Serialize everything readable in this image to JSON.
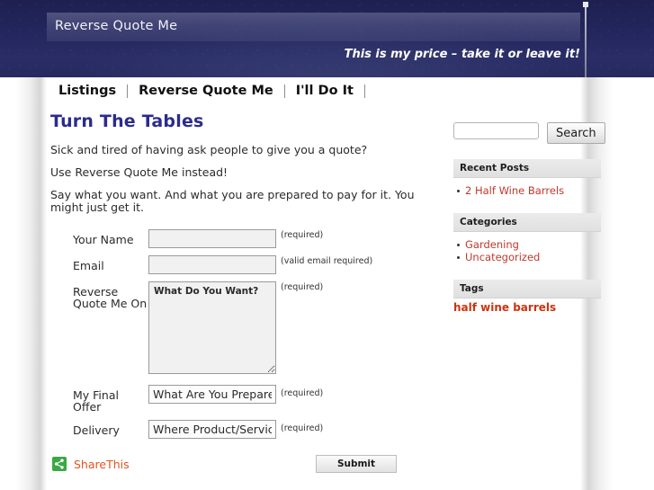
{
  "header": {
    "site_title": "Reverse Quote Me",
    "tagline": "This is my price – take it or leave it!",
    "bg_color": "#23265c",
    "title_text_color": "#f2f2f7"
  },
  "nav": {
    "items": [
      {
        "label": "Listings"
      },
      {
        "label": "Reverse Quote Me"
      },
      {
        "label": "I'll Do It"
      }
    ]
  },
  "main": {
    "page_title": "Turn The Tables",
    "page_title_color": "#2b2b8f",
    "paragraphs": [
      "Sick and tired of having ask people to give you a quote?",
      "Use Reverse Quote Me instead!",
      "Say what you want. And what you are prepared to pay for it. You might just get it."
    ],
    "form": {
      "fields": [
        {
          "label": "Your Name",
          "type": "text",
          "value": "",
          "placeholder": "",
          "hint": "(required)"
        },
        {
          "label": "Email",
          "type": "text",
          "value": "",
          "placeholder": "",
          "hint": "(valid email required)"
        },
        {
          "label": "Reverse Quote Me On",
          "type": "textarea",
          "value": "What Do You Want?",
          "placeholder": "",
          "hint": "(required)"
        },
        {
          "label": "My Final Offer",
          "type": "text",
          "value": "What Are You Prepared To Pay?",
          "placeholder": "",
          "hint": "(required)"
        },
        {
          "label": "Delivery",
          "type": "text",
          "value": "Where Product/Service Is Needed",
          "placeholder": "",
          "hint": "(required)"
        }
      ],
      "submit_label": "Submit"
    },
    "share": {
      "label": "ShareThis",
      "icon": "share-icon",
      "icon_bg": "#3aa845",
      "label_color": "#e4541e"
    }
  },
  "sidebar": {
    "search": {
      "value": "",
      "placeholder": "",
      "button_label": "Search"
    },
    "widgets": [
      {
        "title": "Recent Posts",
        "items": [
          "2 Half Wine Barrels"
        ]
      },
      {
        "title": "Categories",
        "items": [
          "Gardening",
          "Uncategorized"
        ]
      }
    ],
    "tags": {
      "title": "Tags",
      "items": [
        "half wine barrels"
      ],
      "color": "#cc3311"
    }
  }
}
